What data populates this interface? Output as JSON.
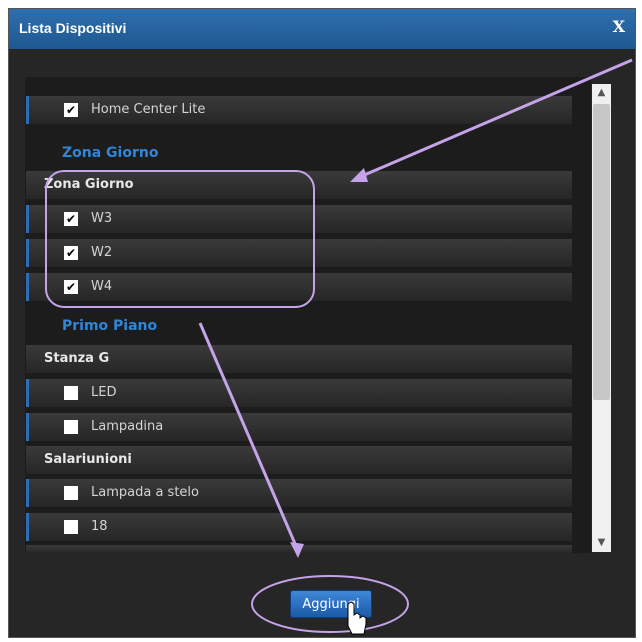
{
  "dialog": {
    "title": "Lista Dispositivi",
    "close_label": "X",
    "add_button_label": "Aggiungi"
  },
  "list": {
    "top_device": {
      "label": "Home Center Lite",
      "checked": true
    },
    "zones": [
      {
        "name": "Zona Giorno",
        "rooms": [
          {
            "name": "Zona Giorno",
            "devices": [
              {
                "label": "W3",
                "checked": true
              },
              {
                "label": "W2",
                "checked": true
              },
              {
                "label": "W4",
                "checked": true
              }
            ]
          }
        ]
      },
      {
        "name": "Primo Piano",
        "rooms": [
          {
            "name": "Stanza G",
            "devices": [
              {
                "label": "LED",
                "checked": false
              },
              {
                "label": "Lampadina",
                "checked": false
              }
            ]
          },
          {
            "name": "Salariunioni",
            "devices": [
              {
                "label": "Lampada a stelo",
                "checked": false
              },
              {
                "label": "18",
                "checked": false
              }
            ]
          }
        ]
      }
    ]
  },
  "colors": {
    "titlebar": "#1e5891",
    "zone_text": "#2f86d8",
    "annotation": "#c4a3e8",
    "button": "#2a70c4"
  }
}
